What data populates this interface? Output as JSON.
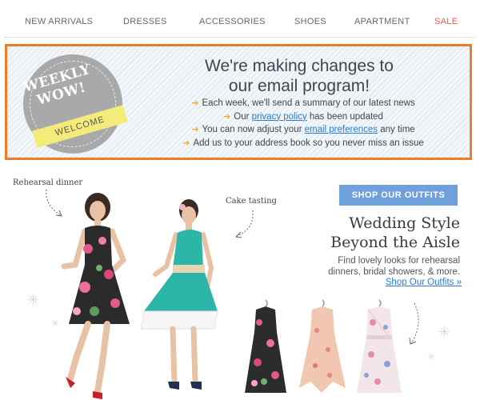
{
  "nav": {
    "items": [
      {
        "label": "NEW ARRIVALS"
      },
      {
        "label": "DRESSES"
      },
      {
        "label": "ACCESSORIES"
      },
      {
        "label": "SHOES"
      },
      {
        "label": "APARTMENT"
      },
      {
        "label": "SALE"
      }
    ]
  },
  "banner": {
    "badge_line1": "WEEKLY",
    "badge_line2": "WOW!",
    "badge_ribbon": "WELCOME",
    "title_line1": "We're making changes to",
    "title_line2": "our email program!",
    "bullets": [
      {
        "pre": "Each week, we'll send a summary of our latest news",
        "link": "",
        "post": ""
      },
      {
        "pre": "Our ",
        "link": "privacy policy",
        "post": " has been updated"
      },
      {
        "pre": "You can now adjust your ",
        "link": "email preferences",
        "post": " any time"
      },
      {
        "pre": "Add us to your address book so you never miss an issue",
        "link": "",
        "post": ""
      }
    ],
    "colors": {
      "border": "#ef7d26",
      "link": "#2b7bd6",
      "arrow": "#f0b22a",
      "ribbon": "#f3ec7a"
    }
  },
  "lower": {
    "caption_rehearsal": "Rehearsal dinner",
    "caption_cake": "Cake tasting",
    "shop_button": "SHOP OUR OUTFITS",
    "title_line1": "Wedding Style",
    "title_line2": "Beyond the Aisle",
    "subtitle_line1": "Find lovely looks for rehearsal",
    "subtitle_line2": "dinners, bridal showers, & more.",
    "link": "Shop Our Outfits »"
  }
}
